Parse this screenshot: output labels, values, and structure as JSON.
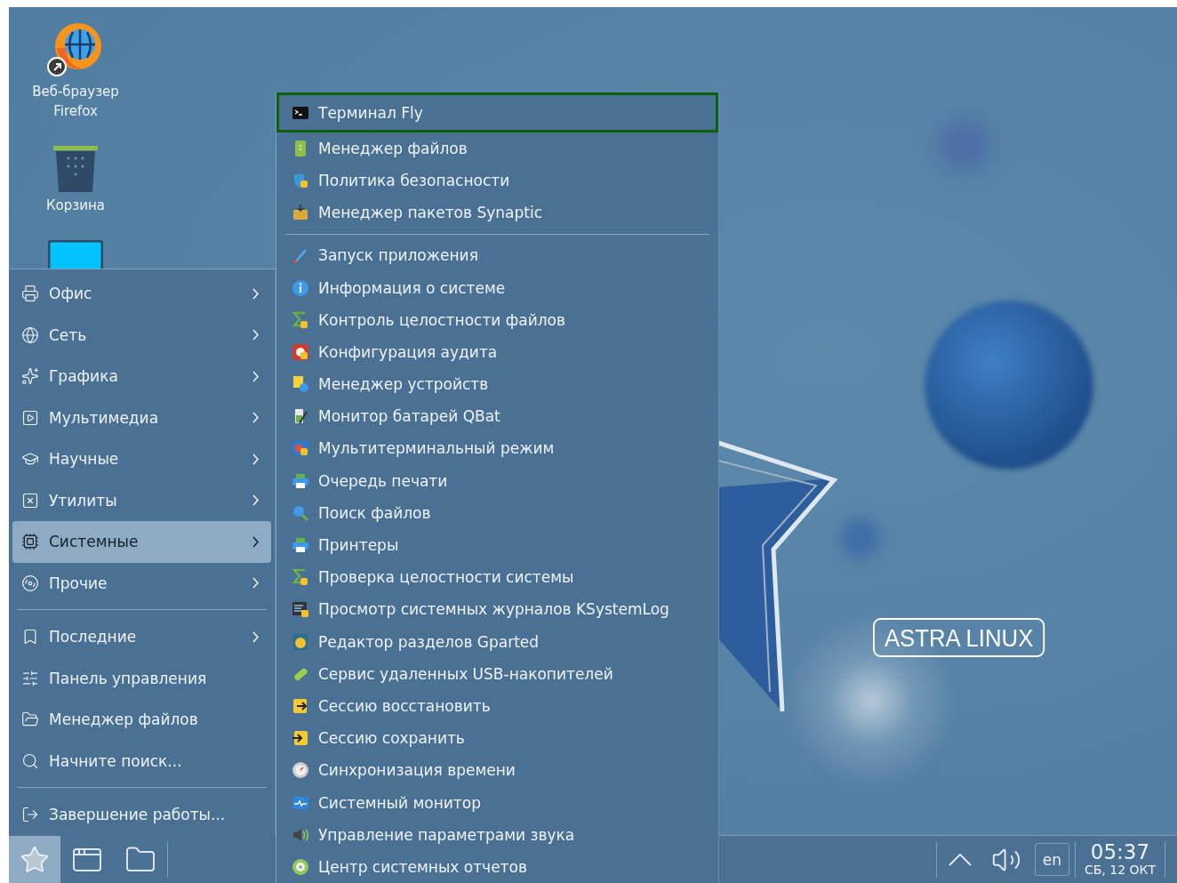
{
  "desktop_icons": [
    {
      "kind": "browser",
      "label": "Веб-браузер Firefox"
    },
    {
      "kind": "trash",
      "label": "Корзина"
    }
  ],
  "wallpaper": {
    "logo": "ASTRA LINUX"
  },
  "main_menu": {
    "sections": [
      {
        "items": [
          {
            "label": "Офис",
            "has_submenu": true,
            "selected": false
          },
          {
            "label": "Сеть",
            "has_submenu": true,
            "selected": false
          },
          {
            "label": "Графика",
            "has_submenu": true,
            "selected": false
          },
          {
            "label": "Мультимедиа",
            "has_submenu": true,
            "selected": false
          },
          {
            "label": "Научные",
            "has_submenu": true,
            "selected": false
          },
          {
            "label": "Утилиты",
            "has_submenu": true,
            "selected": false
          },
          {
            "label": "Системные",
            "has_submenu": true,
            "selected": true
          },
          {
            "label": "Прочие",
            "has_submenu": true,
            "selected": false
          }
        ]
      },
      {
        "items": [
          {
            "label": "Последние",
            "has_submenu": true,
            "selected": false
          },
          {
            "label": "Панель управления",
            "has_submenu": false,
            "selected": false
          },
          {
            "label": "Менеджер файлов",
            "has_submenu": false,
            "selected": false
          },
          {
            "label": "Начните поиск...",
            "has_submenu": false,
            "selected": false
          }
        ]
      },
      {
        "items": [
          {
            "label": "Завершение работы...",
            "has_submenu": false,
            "selected": false
          }
        ]
      }
    ]
  },
  "submenu": {
    "sections": [
      {
        "items": [
          {
            "label": "Терминал Fly",
            "selected": true
          },
          {
            "label": "Менеджер файлов",
            "selected": false
          },
          {
            "label": "Политика безопасности",
            "selected": false
          },
          {
            "label": "Менеджер пакетов Synaptic",
            "selected": false
          }
        ]
      },
      {
        "items": [
          {
            "label": "Запуск приложения",
            "selected": false
          },
          {
            "label": "Информация о системе",
            "selected": false
          },
          {
            "label": "Контроль целостности файлов",
            "selected": false
          },
          {
            "label": "Конфигурация аудита",
            "selected": false
          },
          {
            "label": "Менеджер устройств",
            "selected": false
          },
          {
            "label": "Монитор батарей QBat",
            "selected": false
          },
          {
            "label": "Мультитерминальный режим",
            "selected": false
          },
          {
            "label": "Очередь печати",
            "selected": false
          },
          {
            "label": "Поиск файлов",
            "selected": false
          },
          {
            "label": "Принтеры",
            "selected": false
          },
          {
            "label": "Проверка целостности системы",
            "selected": false
          },
          {
            "label": "Просмотр системных журналов KSystemLog",
            "selected": false
          },
          {
            "label": "Редактор разделов Gparted",
            "selected": false
          },
          {
            "label": "Сервис удаленных USB-накопителей",
            "selected": false
          },
          {
            "label": "Сессию восстановить",
            "selected": false
          },
          {
            "label": "Сессию сохранить",
            "selected": false
          },
          {
            "label": "Синхронизация времени",
            "selected": false
          },
          {
            "label": "Системный монитор",
            "selected": false
          },
          {
            "label": "Управление параметрами звука",
            "selected": false
          },
          {
            "label": "Центр системных отчетов",
            "selected": false
          }
        ]
      }
    ]
  },
  "taskbar": {
    "start_button": {
      "selected": true
    },
    "language": "en",
    "time": "05:37",
    "date": "СБ, 12 ОКТ"
  }
}
